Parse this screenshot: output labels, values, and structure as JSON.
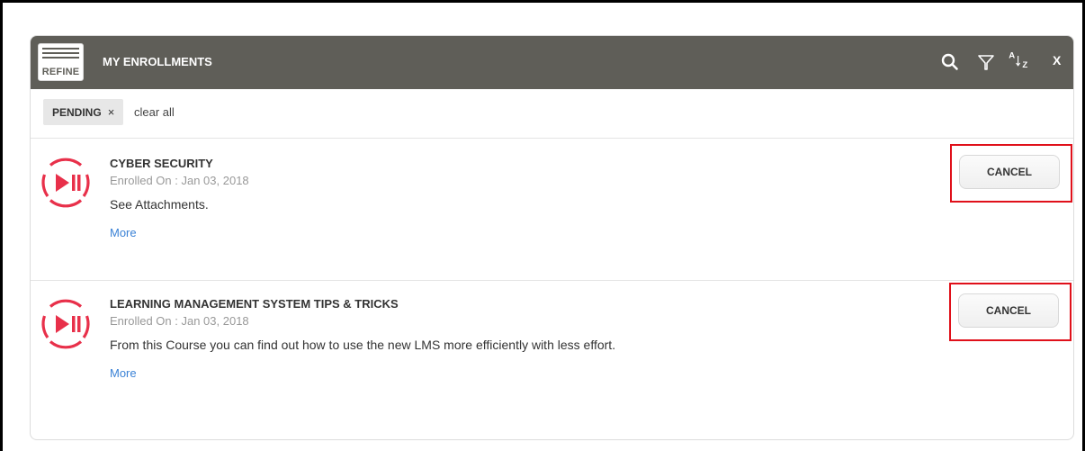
{
  "header": {
    "refine_label": "REFINE",
    "title": "MY ENROLLMENTS",
    "close_label": "X",
    "icons": [
      "search-icon",
      "filter-icon",
      "sort-az-icon"
    ],
    "sort_label_a": "A",
    "sort_label_z": "Z"
  },
  "filters": {
    "chips": [
      {
        "label": "PENDING",
        "remove": "×"
      }
    ],
    "clear_all": "clear all"
  },
  "courses": [
    {
      "title": "CYBER SECURITY",
      "enrolled": "Enrolled On : Jan 03, 2018",
      "description": "See Attachments.",
      "more": "More",
      "action": "CANCEL",
      "icon": "play-pause-icon"
    },
    {
      "title": "LEARNING MANAGEMENT SYSTEM TIPS & TRICKS",
      "enrolled": "Enrolled On : Jan 03, 2018",
      "description": "From this Course you can find out how to use the new LMS more efficiently with less effort.",
      "more": "More",
      "action": "CANCEL",
      "icon": "play-pause-icon"
    }
  ],
  "colors": {
    "header_bg": "#5f5e58",
    "accent_red": "#e8304a",
    "highlight_box": "#e0101a",
    "link_blue": "#3b82d6"
  }
}
